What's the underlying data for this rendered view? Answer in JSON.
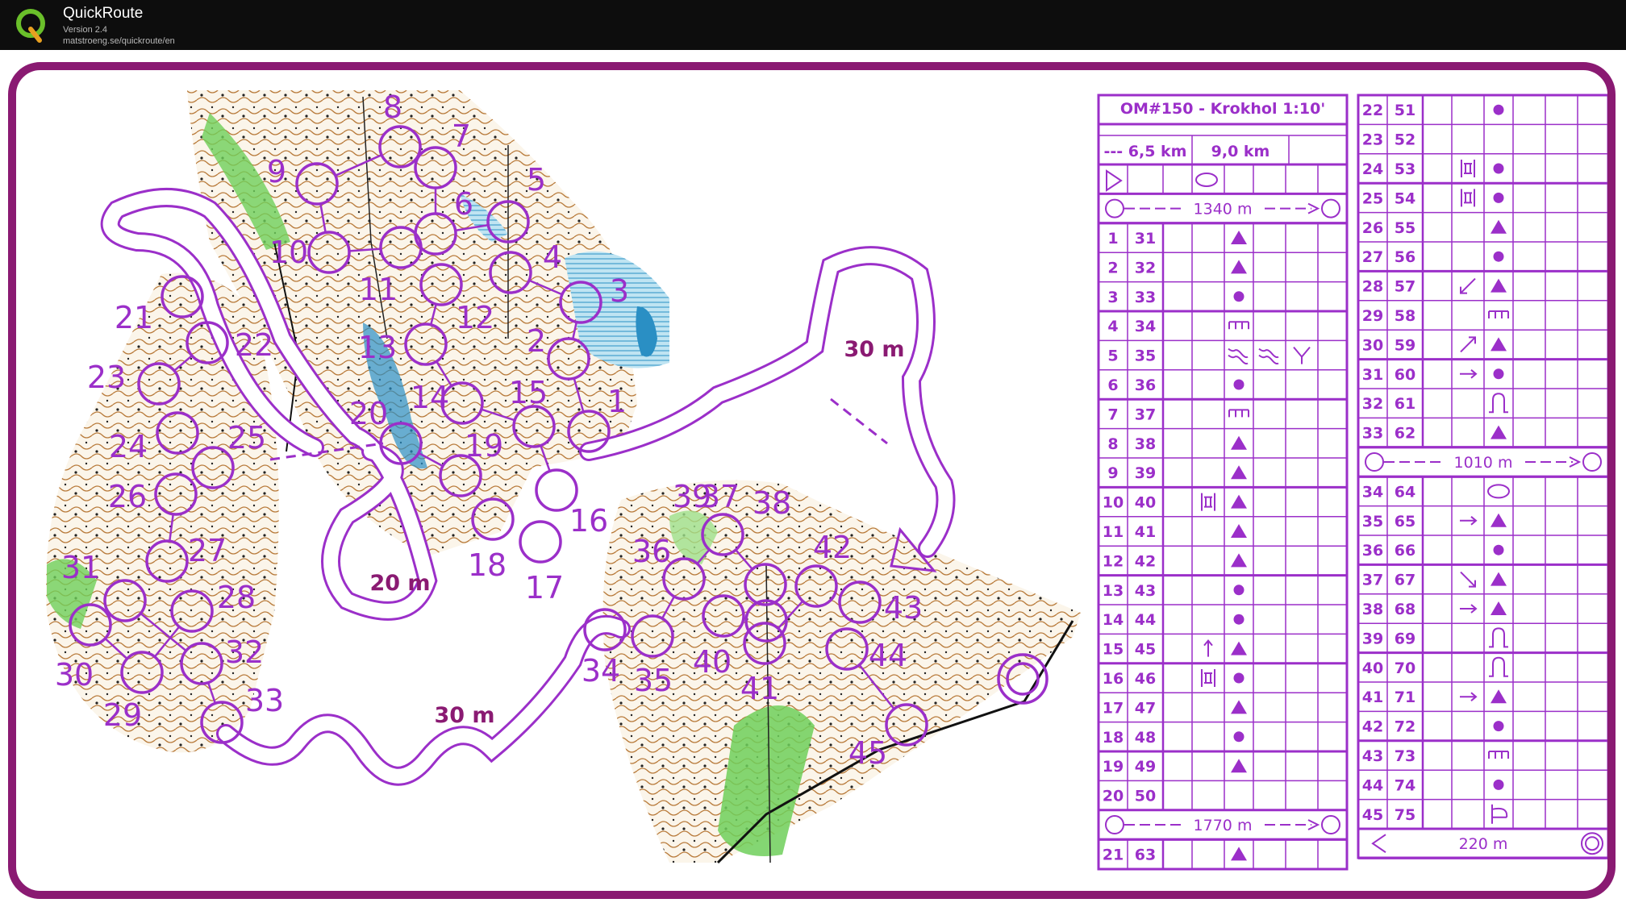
{
  "app": {
    "name": "QuickRoute",
    "version": "Version 2.4",
    "url": "matstroeng.se/quickroute/en",
    "logo_letter": "Q"
  },
  "colors": {
    "frame": "#8a1a72",
    "purple": "#9b2fc9",
    "background": "#ffffff",
    "titlebar": "#0d0d0d"
  },
  "map": {
    "height_labels": [
      "30 m",
      "20 m",
      "30 m"
    ],
    "controls": [
      {
        "n": "1"
      },
      {
        "n": "2"
      },
      {
        "n": "3"
      },
      {
        "n": "4"
      },
      {
        "n": "5"
      },
      {
        "n": "6"
      },
      {
        "n": "7"
      },
      {
        "n": "8"
      },
      {
        "n": "9"
      },
      {
        "n": "10"
      },
      {
        "n": "11"
      },
      {
        "n": "12"
      },
      {
        "n": "13"
      },
      {
        "n": "14"
      },
      {
        "n": "15"
      },
      {
        "n": "16"
      },
      {
        "n": "17"
      },
      {
        "n": "18"
      },
      {
        "n": "19"
      },
      {
        "n": "20"
      },
      {
        "n": "21"
      },
      {
        "n": "22"
      },
      {
        "n": "23"
      },
      {
        "n": "24"
      },
      {
        "n": "25"
      },
      {
        "n": "26"
      },
      {
        "n": "27"
      },
      {
        "n": "28"
      },
      {
        "n": "29"
      },
      {
        "n": "30"
      },
      {
        "n": "31"
      },
      {
        "n": "32"
      },
      {
        "n": "33"
      },
      {
        "n": "34"
      },
      {
        "n": "35"
      },
      {
        "n": "36"
      },
      {
        "n": "37"
      },
      {
        "n": "38"
      },
      {
        "n": "39"
      },
      {
        "n": "40"
      },
      {
        "n": "41"
      },
      {
        "n": "42"
      },
      {
        "n": "43"
      },
      {
        "n": "44"
      },
      {
        "n": "45"
      }
    ]
  },
  "description_table": {
    "title": "OM#150 - Krokhol 1:10'",
    "dist_short": "--- 6,5 km",
    "dist_long": "9,0 km",
    "legs_left": [
      {
        "after": "start",
        "length": "1340 m"
      },
      {
        "after": "20",
        "length": "1770 m"
      }
    ],
    "legs_right": [
      {
        "after": "33",
        "length": "1010 m"
      },
      {
        "after": "45",
        "length": "220 m"
      }
    ],
    "rows": [
      {
        "num": "1",
        "code": "31",
        "dir": "",
        "fea": "tri"
      },
      {
        "num": "2",
        "code": "32",
        "dir": "",
        "fea": "tri"
      },
      {
        "num": "3",
        "code": "33",
        "dir": "",
        "fea": "dot"
      },
      {
        "num": "4",
        "code": "34",
        "dir": "",
        "fea": "comb"
      },
      {
        "num": "5",
        "code": "35",
        "dir": "",
        "fea": "squig",
        "fea2": "squig",
        "fea3": "fork"
      },
      {
        "num": "6",
        "code": "36",
        "dir": "",
        "fea": "dot"
      },
      {
        "num": "7",
        "code": "37",
        "dir": "",
        "fea": "comb"
      },
      {
        "num": "8",
        "code": "38",
        "dir": "",
        "fea": "tri"
      },
      {
        "num": "9",
        "code": "39",
        "dir": "",
        "fea": "tri"
      },
      {
        "num": "10",
        "code": "40",
        "dir": "bars",
        "fea": "tri"
      },
      {
        "num": "11",
        "code": "41",
        "dir": "",
        "fea": "tri"
      },
      {
        "num": "12",
        "code": "42",
        "dir": "",
        "fea": "tri"
      },
      {
        "num": "13",
        "code": "43",
        "dir": "",
        "fea": "dot"
      },
      {
        "num": "14",
        "code": "44",
        "dir": "",
        "fea": "dot"
      },
      {
        "num": "15",
        "code": "45",
        "dir": "up",
        "fea": "tri"
      },
      {
        "num": "16",
        "code": "46",
        "dir": "bars",
        "fea": "dot"
      },
      {
        "num": "17",
        "code": "47",
        "dir": "",
        "fea": "tri"
      },
      {
        "num": "18",
        "code": "48",
        "dir": "",
        "fea": "dot"
      },
      {
        "num": "19",
        "code": "49",
        "dir": "",
        "fea": "tri"
      },
      {
        "num": "20",
        "code": "50",
        "dir": "",
        "fea": ""
      },
      {
        "num": "21",
        "code": "63",
        "dir": "",
        "fea": "tri"
      },
      {
        "num": "22",
        "code": "51",
        "dir": "",
        "fea": "dot"
      },
      {
        "num": "23",
        "code": "52",
        "dir": "",
        "fea": ""
      },
      {
        "num": "24",
        "code": "53",
        "dir": "bars",
        "fea": "dot"
      },
      {
        "num": "25",
        "code": "54",
        "dir": "bars",
        "fea": "dot"
      },
      {
        "num": "26",
        "code": "55",
        "dir": "",
        "fea": "tri"
      },
      {
        "num": "27",
        "code": "56",
        "dir": "",
        "fea": "dot"
      },
      {
        "num": "28",
        "code": "57",
        "dir": "sw",
        "fea": "tri"
      },
      {
        "num": "29",
        "code": "58",
        "dir": "",
        "fea": "comb"
      },
      {
        "num": "30",
        "code": "59",
        "dir": "ne",
        "fea": "tri"
      },
      {
        "num": "31",
        "code": "60",
        "dir": "right",
        "fea": "dot"
      },
      {
        "num": "32",
        "code": "61",
        "dir": "",
        "fea": "arch"
      },
      {
        "num": "33",
        "code": "62",
        "dir": "",
        "fea": "tri"
      },
      {
        "num": "34",
        "code": "64",
        "dir": "",
        "fea": "oval"
      },
      {
        "num": "35",
        "code": "65",
        "dir": "right",
        "fea": "tri"
      },
      {
        "num": "36",
        "code": "66",
        "dir": "",
        "fea": "dot"
      },
      {
        "num": "37",
        "code": "67",
        "dir": "se",
        "fea": "tri"
      },
      {
        "num": "38",
        "code": "68",
        "dir": "right",
        "fea": "tri"
      },
      {
        "num": "39",
        "code": "69",
        "dir": "",
        "fea": "arch"
      },
      {
        "num": "40",
        "code": "70",
        "dir": "",
        "fea": "arch"
      },
      {
        "num": "41",
        "code": "71",
        "dir": "right",
        "fea": "tri"
      },
      {
        "num": "42",
        "code": "72",
        "dir": "",
        "fea": "dot"
      },
      {
        "num": "43",
        "code": "73",
        "dir": "",
        "fea": "comb"
      },
      {
        "num": "44",
        "code": "74",
        "dir": "",
        "fea": "dot"
      },
      {
        "num": "45",
        "code": "75",
        "dir": "",
        "fea": "gate"
      }
    ]
  }
}
